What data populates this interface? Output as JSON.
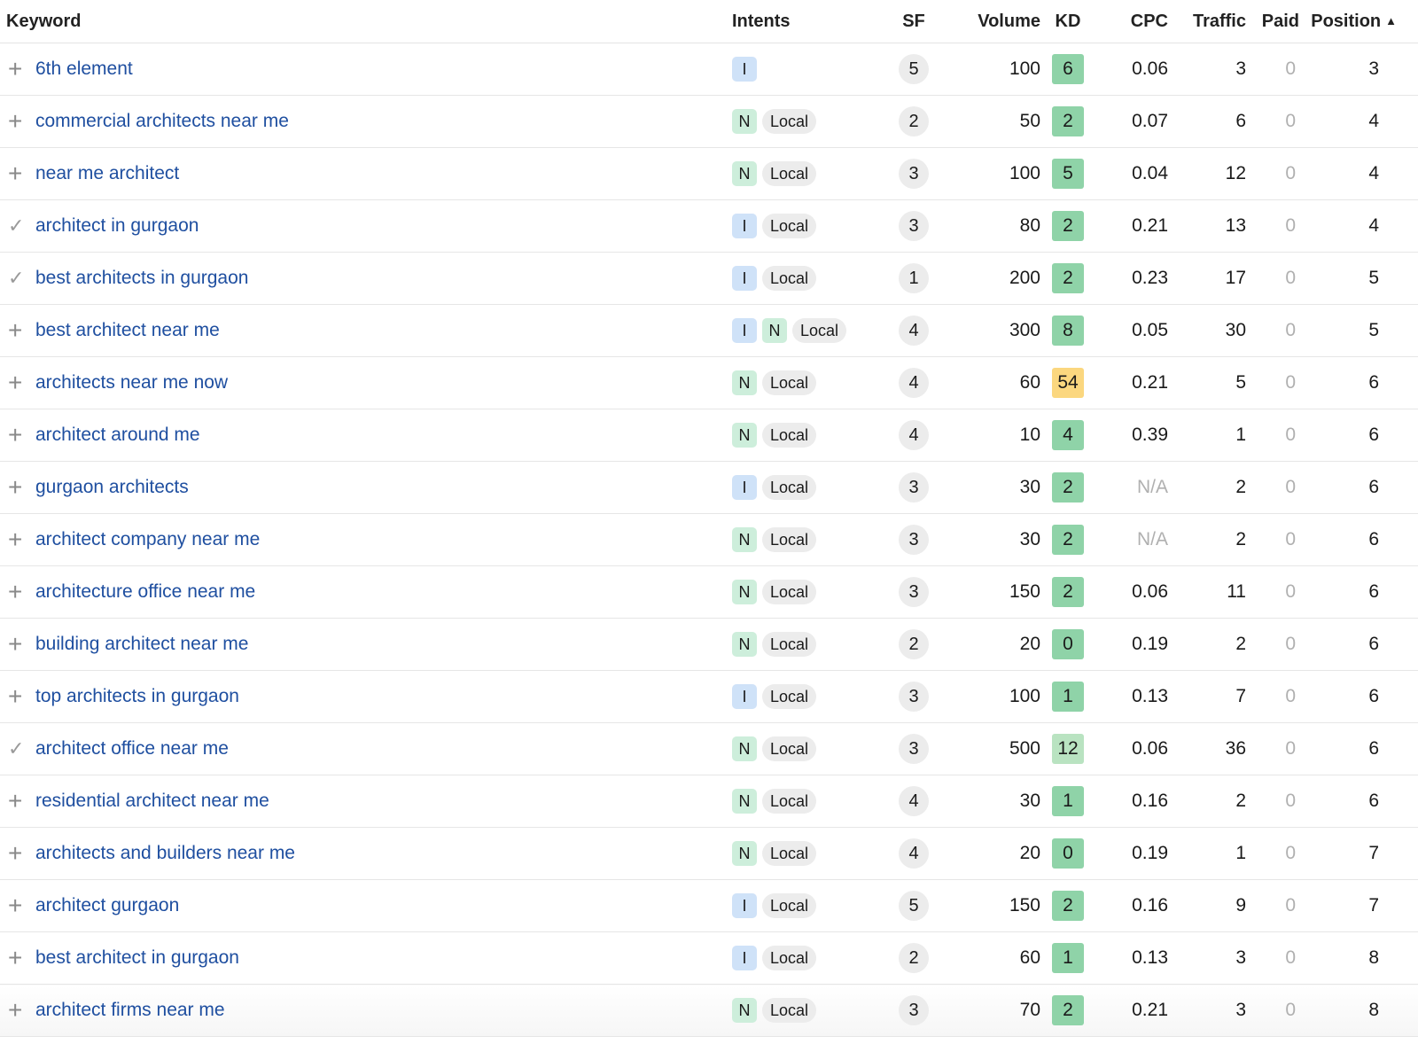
{
  "columns": {
    "keyword": "Keyword",
    "intents": "Intents",
    "sf": "SF",
    "volume": "Volume",
    "kd": "KD",
    "cpc": "CPC",
    "traffic": "Traffic",
    "paid": "Paid",
    "position": "Position",
    "sort_indicator": "▲"
  },
  "colors": {
    "keyword_link": "#1f4fa0",
    "kd_easy": "#8fd3a8",
    "kd_light": "#b9e3c1",
    "kd_medium": "#fbd77f",
    "intent_informational": "#cfe2f8",
    "intent_navigational": "#cdeedb"
  },
  "icons": {
    "add": "plus-icon",
    "added": "checkmark-icon"
  },
  "rows": [
    {
      "action": "+",
      "keyword": "6th element",
      "intents": [
        "I"
      ],
      "local": "",
      "sf": "5",
      "volume": "100",
      "kd": "6",
      "kd_level": "easy",
      "cpc": "0.06",
      "traffic": "3",
      "paid": "0",
      "position": "3"
    },
    {
      "action": "+",
      "keyword": "commercial architects near me",
      "intents": [
        "N"
      ],
      "local": "Local",
      "sf": "2",
      "volume": "50",
      "kd": "2",
      "kd_level": "easy",
      "cpc": "0.07",
      "traffic": "6",
      "paid": "0",
      "position": "4"
    },
    {
      "action": "+",
      "keyword": "near me architect",
      "intents": [
        "N"
      ],
      "local": "Local",
      "sf": "3",
      "volume": "100",
      "kd": "5",
      "kd_level": "easy",
      "cpc": "0.04",
      "traffic": "12",
      "paid": "0",
      "position": "4"
    },
    {
      "action": "✓",
      "keyword": "architect in gurgaon",
      "intents": [
        "I"
      ],
      "local": "Local",
      "sf": "3",
      "volume": "80",
      "kd": "2",
      "kd_level": "easy",
      "cpc": "0.21",
      "traffic": "13",
      "paid": "0",
      "position": "4"
    },
    {
      "action": "✓",
      "keyword": "best architects in gurgaon",
      "intents": [
        "I"
      ],
      "local": "Local",
      "sf": "1",
      "volume": "200",
      "kd": "2",
      "kd_level": "easy",
      "cpc": "0.23",
      "traffic": "17",
      "paid": "0",
      "position": "5"
    },
    {
      "action": "+",
      "keyword": "best architect near me",
      "intents": [
        "I",
        "N"
      ],
      "local": "Local",
      "sf": "4",
      "volume": "300",
      "kd": "8",
      "kd_level": "easy",
      "cpc": "0.05",
      "traffic": "30",
      "paid": "0",
      "position": "5"
    },
    {
      "action": "+",
      "keyword": "architects near me now",
      "intents": [
        "N"
      ],
      "local": "Local",
      "sf": "4",
      "volume": "60",
      "kd": "54",
      "kd_level": "medium",
      "cpc": "0.21",
      "traffic": "5",
      "paid": "0",
      "position": "6"
    },
    {
      "action": "+",
      "keyword": "architect around me",
      "intents": [
        "N"
      ],
      "local": "Local",
      "sf": "4",
      "volume": "10",
      "kd": "4",
      "kd_level": "easy",
      "cpc": "0.39",
      "traffic": "1",
      "paid": "0",
      "position": "6"
    },
    {
      "action": "+",
      "keyword": "gurgaon architects",
      "intents": [
        "I"
      ],
      "local": "Local",
      "sf": "3",
      "volume": "30",
      "kd": "2",
      "kd_level": "easy",
      "cpc": "N/A",
      "traffic": "2",
      "paid": "0",
      "position": "6"
    },
    {
      "action": "+",
      "keyword": "architect company near me",
      "intents": [
        "N"
      ],
      "local": "Local",
      "sf": "3",
      "volume": "30",
      "kd": "2",
      "kd_level": "easy",
      "cpc": "N/A",
      "traffic": "2",
      "paid": "0",
      "position": "6"
    },
    {
      "action": "+",
      "keyword": "architecture office near me",
      "intents": [
        "N"
      ],
      "local": "Local",
      "sf": "3",
      "volume": "150",
      "kd": "2",
      "kd_level": "easy",
      "cpc": "0.06",
      "traffic": "11",
      "paid": "0",
      "position": "6"
    },
    {
      "action": "+",
      "keyword": "building architect near me",
      "intents": [
        "N"
      ],
      "local": "Local",
      "sf": "2",
      "volume": "20",
      "kd": "0",
      "kd_level": "easy",
      "cpc": "0.19",
      "traffic": "2",
      "paid": "0",
      "position": "6"
    },
    {
      "action": "+",
      "keyword": "top architects in gurgaon",
      "intents": [
        "I"
      ],
      "local": "Local",
      "sf": "3",
      "volume": "100",
      "kd": "1",
      "kd_level": "easy",
      "cpc": "0.13",
      "traffic": "7",
      "paid": "0",
      "position": "6"
    },
    {
      "action": "✓",
      "keyword": "architect office near me",
      "intents": [
        "N"
      ],
      "local": "Local",
      "sf": "3",
      "volume": "500",
      "kd": "12",
      "kd_level": "light",
      "cpc": "0.06",
      "traffic": "36",
      "paid": "0",
      "position": "6"
    },
    {
      "action": "+",
      "keyword": "residential architect near me",
      "intents": [
        "N"
      ],
      "local": "Local",
      "sf": "4",
      "volume": "30",
      "kd": "1",
      "kd_level": "easy",
      "cpc": "0.16",
      "traffic": "2",
      "paid": "0",
      "position": "6"
    },
    {
      "action": "+",
      "keyword": "architects and builders near me",
      "intents": [
        "N"
      ],
      "local": "Local",
      "sf": "4",
      "volume": "20",
      "kd": "0",
      "kd_level": "easy",
      "cpc": "0.19",
      "traffic": "1",
      "paid": "0",
      "position": "7"
    },
    {
      "action": "+",
      "keyword": "architect gurgaon",
      "intents": [
        "I"
      ],
      "local": "Local",
      "sf": "5",
      "volume": "150",
      "kd": "2",
      "kd_level": "easy",
      "cpc": "0.16",
      "traffic": "9",
      "paid": "0",
      "position": "7"
    },
    {
      "action": "+",
      "keyword": "best architect in gurgaon",
      "intents": [
        "I"
      ],
      "local": "Local",
      "sf": "2",
      "volume": "60",
      "kd": "1",
      "kd_level": "easy",
      "cpc": "0.13",
      "traffic": "3",
      "paid": "0",
      "position": "8"
    },
    {
      "action": "+",
      "keyword": "architect firms near me",
      "intents": [
        "N"
      ],
      "local": "Local",
      "sf": "3",
      "volume": "70",
      "kd": "2",
      "kd_level": "easy",
      "cpc": "0.21",
      "traffic": "3",
      "paid": "0",
      "position": "8"
    }
  ]
}
